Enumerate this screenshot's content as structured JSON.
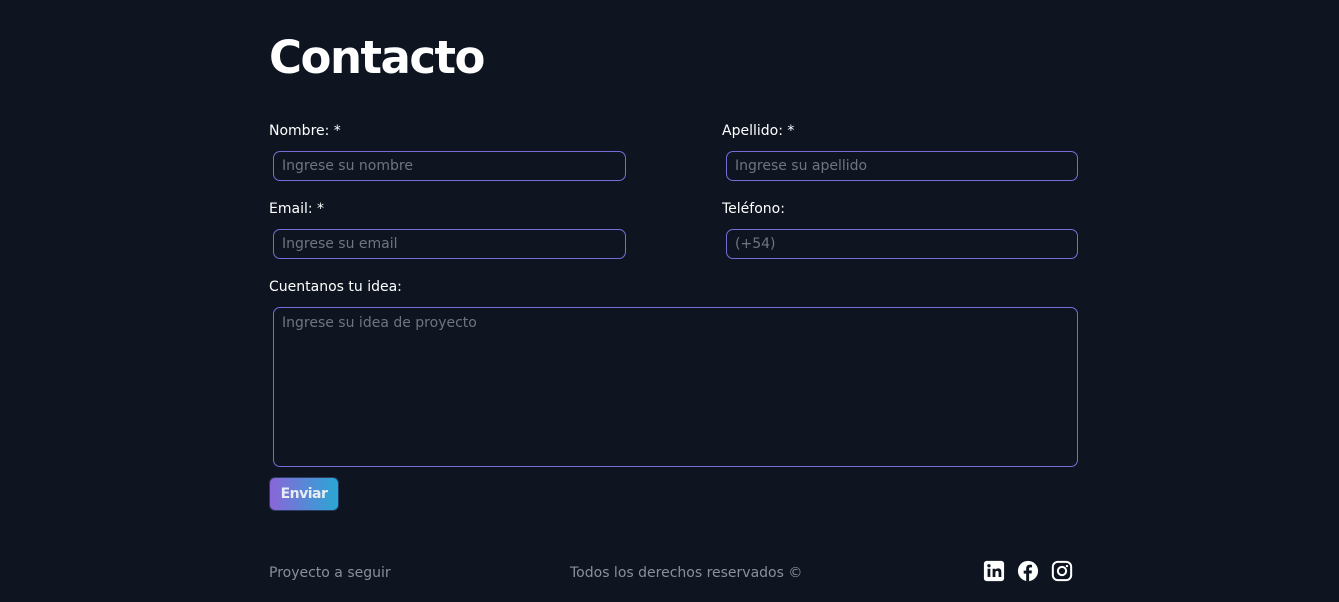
{
  "page": {
    "title": "Contacto"
  },
  "form": {
    "nombre": {
      "label": "Nombre: *",
      "placeholder": "Ingrese su nombre",
      "value": ""
    },
    "apellido": {
      "label": "Apellido: *",
      "placeholder": "Ingrese su apellido",
      "value": ""
    },
    "email": {
      "label": "Email: *",
      "placeholder": "Ingrese su email",
      "value": ""
    },
    "telefono": {
      "label": "Teléfono:",
      "placeholder": "(+54)",
      "value": ""
    },
    "idea": {
      "label": "Cuentanos tu idea:",
      "placeholder": "Ingrese su idea de proyecto",
      "value": ""
    },
    "submit_label": "Enviar"
  },
  "footer": {
    "left_text": "Proyecto a seguir",
    "center_text": "Todos los derechos reservados ©",
    "social_icons": [
      "linkedin-icon",
      "facebook-icon",
      "instagram-icon"
    ]
  },
  "colors": {
    "background": "#0e1521",
    "input_border": "#7b6bd6",
    "button_gradient_start": "#8a66d9",
    "button_gradient_end": "#2aa7d4",
    "footer_text": "#8a8f99"
  }
}
